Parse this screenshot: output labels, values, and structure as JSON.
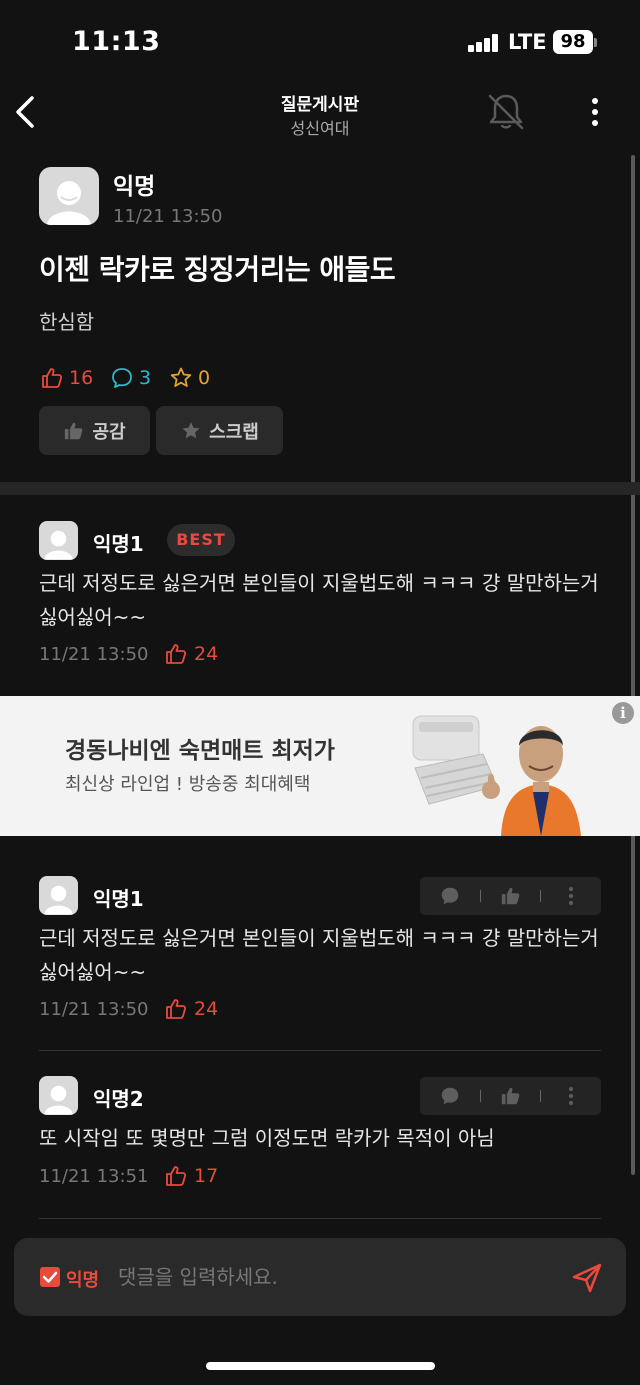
{
  "status_bar": {
    "time": "11:13",
    "network": "LTE",
    "battery": "98"
  },
  "nav": {
    "title": "질문게시판",
    "subtitle": "성신여대"
  },
  "post": {
    "author": "익명",
    "time": "11/21 13:50",
    "title": "이젠 락카로 징징거리는 애들도",
    "body": "한심함",
    "likes": "16",
    "comments": "3",
    "scraps": "0",
    "like_button": "공감",
    "scrap_button": "스크랩"
  },
  "best_comment": {
    "author": "익명1",
    "badge": "BEST",
    "text": "근데 저정도로 싫은거면 본인들이 지울법도해 ㅋㅋㅋ 걍 말만하는거 싫어싫어~~",
    "time": "11/21 13:50",
    "likes": "24"
  },
  "ad": {
    "title": "경동나비엔 숙면매트 최저가",
    "subtitle": "최신상 라인업 ! 방송중 최대혜택",
    "info": "i"
  },
  "comments": [
    {
      "author": "익명1",
      "text": "근데 저정도로 싫은거면 본인들이 지울법도해 ㅋㅋㅋ 걍 말만하는거 싫어싫어~~",
      "time": "11/21 13:50",
      "likes": "24"
    },
    {
      "author": "익명2",
      "text": "또 시작임 또 몇명만 그럼 이정도면 락카가 목적이 아님",
      "time": "11/21 13:51",
      "likes": "17"
    }
  ],
  "input": {
    "anon_label": "익명",
    "placeholder": "댓글을 입력하세요."
  },
  "colors": {
    "background": "#121212",
    "accent": "#e84a3c",
    "comment_accent": "#2bb9c9",
    "scrap_accent": "#e3a330"
  }
}
